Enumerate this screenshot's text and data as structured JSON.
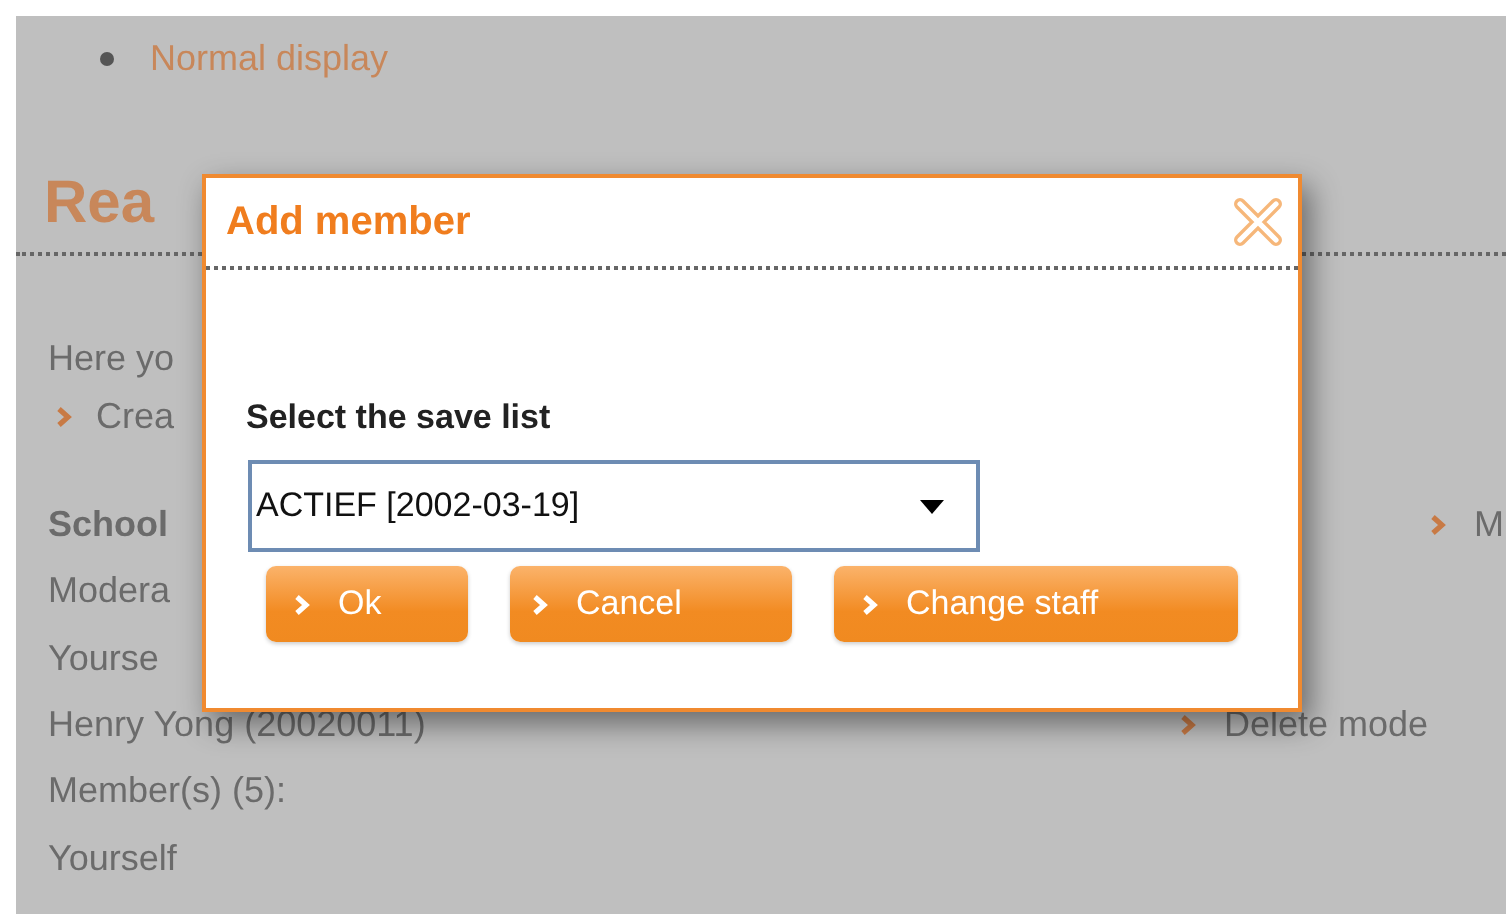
{
  "background_page": {
    "bullet_items": [
      "Normal display"
    ],
    "heading": "Rea",
    "intro": "Here yo",
    "links": [
      {
        "label": "Crea"
      }
    ],
    "rows": [
      {
        "kind": "heading",
        "text": "School",
        "side_link": "M"
      },
      {
        "kind": "text",
        "text": "Modera"
      },
      {
        "kind": "text",
        "text": "Yourse"
      },
      {
        "kind": "text",
        "text": "Henry Yong (20020011)",
        "side_link": "Delete mode"
      },
      {
        "kind": "text",
        "text": "Member(s) (5):"
      },
      {
        "kind": "text",
        "text": "Yourself"
      }
    ]
  },
  "dialog": {
    "title": "Add member",
    "field_label": "Select the save list",
    "select": {
      "value": "ACTIEF [2002-03-19]"
    },
    "buttons": [
      "Ok",
      "Cancel",
      "Change staff"
    ]
  }
}
